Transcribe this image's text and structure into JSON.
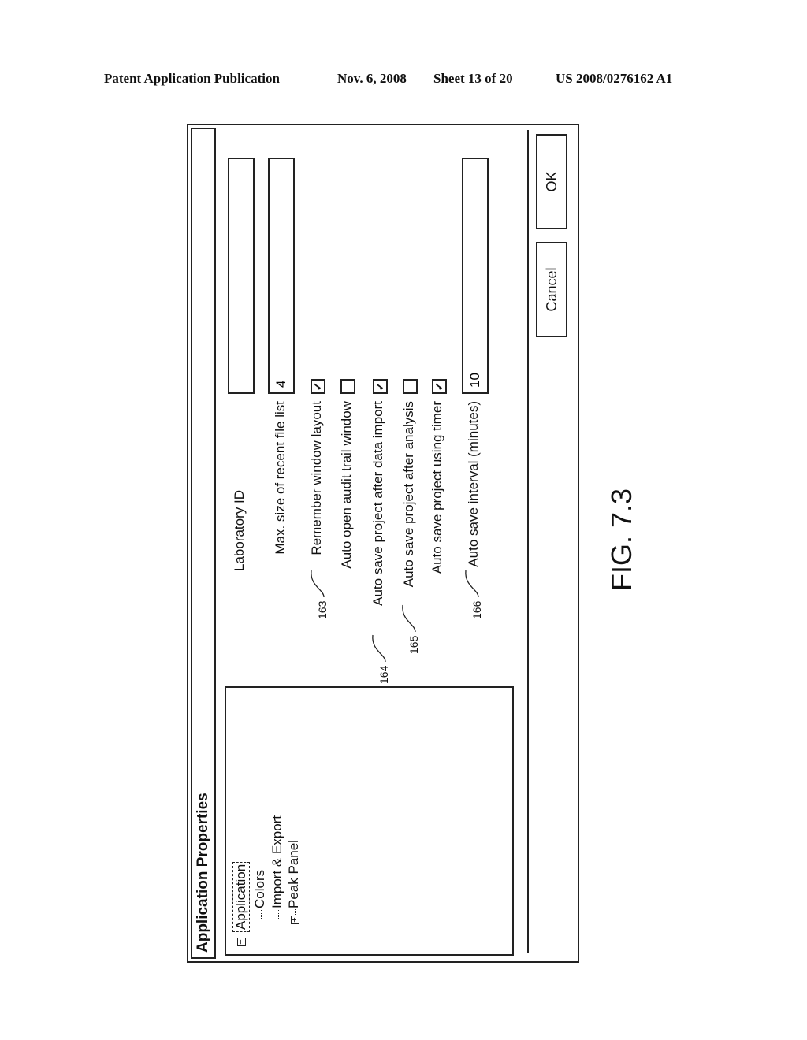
{
  "header": {
    "publication": "Patent Application Publication",
    "date": "Nov. 6, 2008",
    "sheet": "Sheet 13 of 20",
    "number": "US 2008/0276162 A1"
  },
  "dialog": {
    "title": "Application Properties",
    "tree": {
      "root": {
        "label": "Application",
        "expanded": true,
        "selected": true
      },
      "children": [
        {
          "label": "Colors",
          "expandable": false
        },
        {
          "label": "Import & Export",
          "expandable": false
        },
        {
          "label": "Peak Panel",
          "expandable": true,
          "expanded": false
        }
      ]
    },
    "fields": {
      "laboratory_id": {
        "label": "Laboratory ID",
        "value": ""
      },
      "max_recent": {
        "label": "Max. size of recent file list",
        "value": "4"
      },
      "remember_layout": {
        "label": "Remember window layout",
        "checked": true,
        "mark": "✓",
        "ref": "163"
      },
      "auto_open_audit": {
        "label": "Auto open audit trail window",
        "checked": false,
        "mark": ""
      },
      "auto_save_import": {
        "label": "Auto save project after data import",
        "checked": true,
        "mark": "✓",
        "ref": "164"
      },
      "auto_save_analysis": {
        "label": "Auto save project after analysis",
        "checked": false,
        "mark": "",
        "ref": "165"
      },
      "auto_save_timer": {
        "label": "Auto save project using timer",
        "checked": true,
        "mark": "✓"
      },
      "auto_save_interval": {
        "label": "Auto save interval (minutes)",
        "value": "10",
        "ref": "166"
      }
    },
    "buttons": {
      "cancel": "Cancel",
      "ok": "OK"
    },
    "tree_icons": {
      "collapse": "−",
      "expand": "+"
    }
  },
  "figure_label": "FIG. 7.3"
}
